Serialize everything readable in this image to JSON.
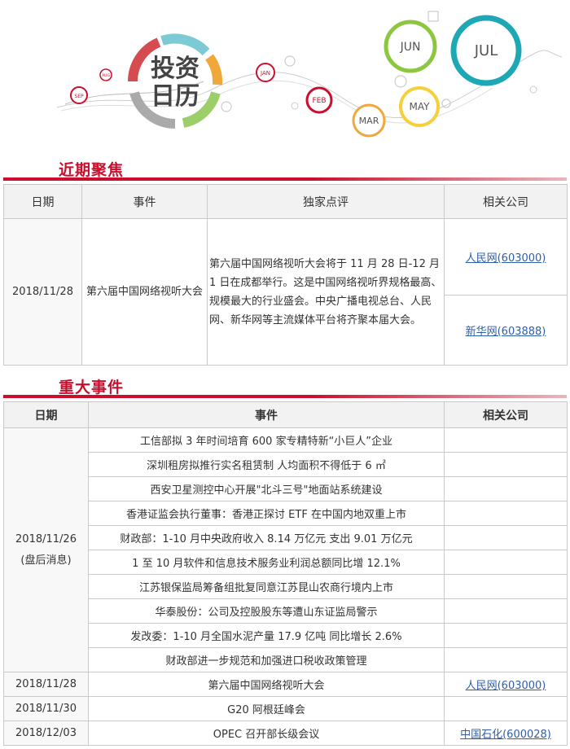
{
  "banner": {
    "logo_line1": "投资",
    "logo_line2": "日历",
    "months": {
      "sep": "SEP",
      "aug": "AUG",
      "jan": "JAN",
      "feb": "FEB",
      "mar": "MAR",
      "may": "MAY",
      "jun": "JUN",
      "jul": "JUL"
    }
  },
  "focus": {
    "title": "近期聚焦",
    "headers": [
      "日期",
      "事件",
      "独家点评",
      "相关公司"
    ],
    "date": "2018/11/28",
    "event": "第六届中国网络视听大会",
    "comment": "第六届中国网络视听大会将于 11 月 28 日-12 月 1 日在成都举行。这是中国网络视听界规格最高、规模最大的行业盛会。中央广播电视总台、人民网、新华网等主流媒体平台将齐聚本届大会。",
    "companies": [
      "人民网(603000)",
      "新华网(603888)"
    ]
  },
  "events": {
    "title": "重大事件",
    "headers": [
      "日期",
      "事件",
      "相关公司"
    ],
    "group_date": "2018/11/26",
    "group_note": "(盘后消息)",
    "group_items": [
      "工信部拟 3 年时间培育 600 家专精特新“小巨人”企业",
      "深圳租房拟推行实名租赁制 人均面积不得低于 6 ㎡",
      "西安卫星测控中心开展\"北斗三号\"地面站系统建设",
      "香港证监会执行董事：香港正探讨 ETF 在中国内地双重上市",
      "财政部：1-10 月中央政府收入 8.14 万亿元 支出 9.01 万亿元",
      "1 至 10 月软件和信息技术服务业利润总额同比增 12.1%",
      "江苏银保监局筹备组批复同意江苏昆山农商行境内上市",
      "华泰股份：公司及控股股东等遭山东证监局警示",
      "发改委：1-10 月全国水泥产量 17.9 亿吨 同比增长 2.6%",
      "财政部进一步规范和加强进口税收政策管理"
    ],
    "rows": [
      {
        "date": "2018/11/28",
        "event": "第六届中国网络视听大会",
        "company": "人民网(603000)"
      },
      {
        "date": "2018/11/30",
        "event": "G20 阿根廷峰会",
        "company": ""
      },
      {
        "date": "2018/12/03",
        "event": "OPEC 召开部长级会议",
        "company": "中国石化(600028)"
      }
    ]
  }
}
